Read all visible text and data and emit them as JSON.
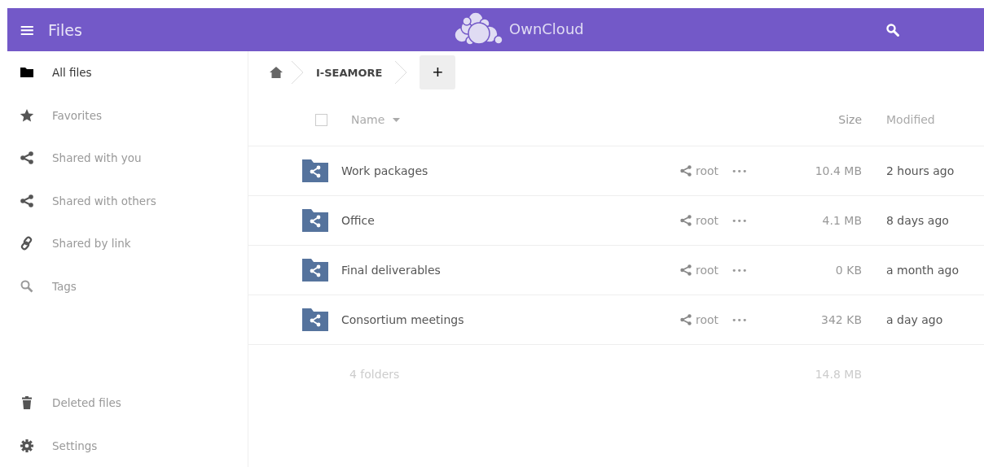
{
  "header": {
    "menu_icon": "≡",
    "title": "Files",
    "brand": "OwnCloud"
  },
  "sidebar": {
    "items": [
      {
        "kind": "folder",
        "label": "All files",
        "selected": true
      },
      {
        "kind": "star",
        "label": "Favorites",
        "selected": false
      },
      {
        "kind": "share",
        "label": "Shared with you",
        "selected": false
      },
      {
        "kind": "share",
        "label": "Shared with others",
        "selected": false
      },
      {
        "kind": "link",
        "label": "Shared by link",
        "selected": false
      },
      {
        "kind": "search",
        "label": "Tags",
        "selected": false
      }
    ],
    "bottom": [
      {
        "kind": "trash",
        "label": "Deleted files",
        "selected": false
      },
      {
        "kind": "gear",
        "label": "Settings",
        "selected": false
      }
    ]
  },
  "breadcrumb": {
    "items": [
      "I-SEAMORE"
    ],
    "add_button": "+"
  },
  "table": {
    "select_all": {
      "checked": false
    },
    "columns": [
      "Name",
      "Size",
      "Modified"
    ],
    "rows": [
      {
        "name": "Work packages",
        "owner": "root",
        "actions": "•••",
        "size": "10.4 MB",
        "modified": "2 hours ago"
      },
      {
        "name": "Office",
        "owner": "root",
        "actions": "•••",
        "size": "4.1 MB",
        "modified": "8 days ago"
      },
      {
        "name": "Final deliverables",
        "owner": "root",
        "actions": "•••",
        "size": "0 KB",
        "modified": "a month ago"
      },
      {
        "name": "Consortium meetings",
        "owner": "root",
        "actions": "•••",
        "size": "342 KB",
        "modified": "a day ago"
      }
    ],
    "summary": {
      "count": "4 folders",
      "size": "14.8 MB"
    }
  }
}
